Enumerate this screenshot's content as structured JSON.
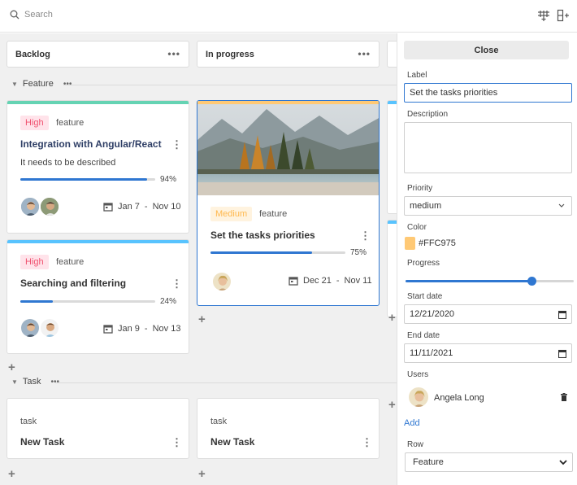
{
  "search": {
    "placeholder": "Search"
  },
  "toolbar": {
    "add_column_icon": "add-column-icon",
    "add_row_icon": "add-row-icon"
  },
  "columns": [
    {
      "title": "Backlog"
    },
    {
      "title": "In progress"
    }
  ],
  "rows": [
    {
      "title": "Feature"
    },
    {
      "title": "Task"
    }
  ],
  "cards": [
    {
      "priority": "High",
      "tag": "feature",
      "title": "Integration with Angular/React",
      "description": "It needs to be described",
      "progress": 94,
      "progress_label": "94%",
      "start": "Jan 7",
      "end": "Nov 10",
      "color": "#65D3B3"
    },
    {
      "priority": "High",
      "tag": "feature",
      "title": "Searching and filtering",
      "progress": 24,
      "progress_label": "24%",
      "start": "Jan 9",
      "end": "Nov 13",
      "color": "#58C3FE"
    },
    {
      "priority": "Medium",
      "tag": "feature",
      "title": "Set the tasks priorities",
      "progress": 75,
      "progress_label": "75%",
      "start": "Dec 21",
      "end": "Nov 11",
      "color": "#FFC975"
    },
    {
      "tag": "task",
      "title": "New Task"
    },
    {
      "tag": "task",
      "title": "New Task"
    }
  ],
  "date_separator": "-",
  "editor": {
    "close_label": "Close",
    "label_label": "Label",
    "label_value": "Set the tasks priorities",
    "description_label": "Description",
    "description_value": "",
    "priority_label": "Priority",
    "priority_value": "medium",
    "color_label": "Color",
    "color_value": "#FFC975",
    "progress_label": "Progress",
    "progress_value": 75,
    "start_label": "Start date",
    "start_value": "12/21/2020",
    "end_label": "End date",
    "end_value": "11/11/2021",
    "users_label": "Users",
    "user_name": "Angela Long",
    "add_label": "Add",
    "row_label": "Row",
    "row_value": "Feature"
  },
  "colors": {
    "accent": "#2F77D1",
    "high_bg": "#FFE3EA",
    "high_text": "#F0506E",
    "medium_bg": "#FFF3DF",
    "medium_text": "#FFB84D"
  }
}
